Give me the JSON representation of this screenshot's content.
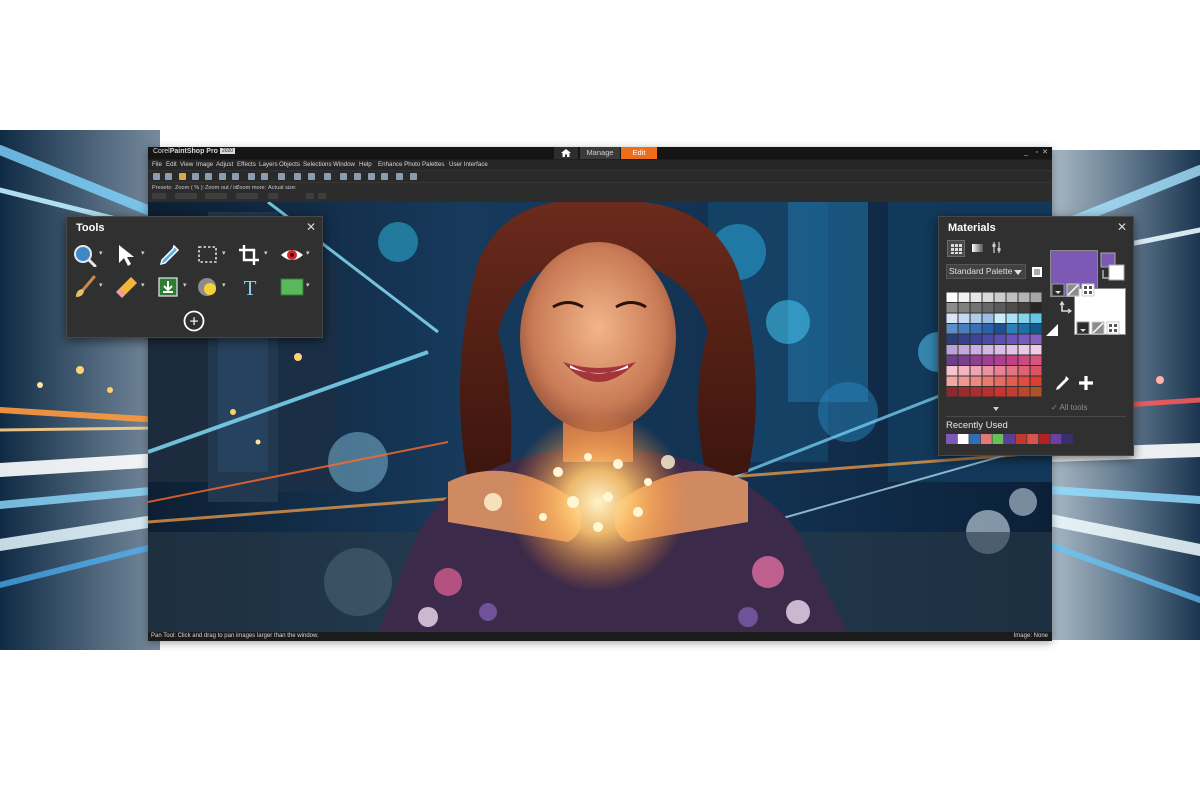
{
  "app": {
    "title_prefix": "Corel",
    "title_brand": "PaintShop Pro",
    "title_year": "2020",
    "tabs": [
      {
        "label": "Manage",
        "active": false
      },
      {
        "label": "Edit",
        "active": true
      }
    ],
    "window_controls": [
      "_",
      "▫",
      "✕"
    ]
  },
  "menu": [
    "File",
    "Edit",
    "View",
    "Image",
    "Adjust",
    "Effects",
    "Layers",
    "Objects",
    "Selections",
    "Window",
    "Help",
    "Enhance Photo",
    "Palettes",
    "User Interface"
  ],
  "options_bar": {
    "labels": [
      "Presets:",
      "Zoom ( % ):",
      "Zoom out / in:",
      "Zoom more:",
      "Actual size:"
    ]
  },
  "status": {
    "hint": "Pan Tool: Click and drag to pan images larger than the window.",
    "image_info": "Image: None"
  },
  "tools_panel": {
    "title": "Tools",
    "close_glyph": "✕",
    "tools": [
      {
        "name": "zoom-tool",
        "has_flyout": true
      },
      {
        "name": "pick-tool",
        "has_flyout": true
      },
      {
        "name": "dropper-tool",
        "has_flyout": false
      },
      {
        "name": "selection-tool",
        "has_flyout": true
      },
      {
        "name": "crop-tool",
        "has_flyout": true
      },
      {
        "name": "red-eye-tool",
        "has_flyout": true
      },
      {
        "name": "paint-brush-tool",
        "has_flyout": true
      },
      {
        "name": "eraser-tool",
        "has_flyout": true
      },
      {
        "name": "clone-tool",
        "has_flyout": true
      },
      {
        "name": "dodge-tool",
        "has_flyout": true
      },
      {
        "name": "text-tool",
        "has_flyout": false
      },
      {
        "name": "rectangle-tool",
        "has_flyout": true
      },
      {
        "name": "add-tool",
        "has_flyout": false
      }
    ],
    "text_tool_glyph": "T",
    "add_glyph": "+"
  },
  "materials_panel": {
    "title": "Materials",
    "close_glyph": "✕",
    "palette_name": "Standard Palette",
    "all_tools_label": "All tools",
    "recently_used_label": "Recently Used",
    "foreground_color": "#7b59b5",
    "background_color": "#ffffff",
    "recent_colors": [
      "#7b59b5",
      "#ffffff",
      "#2f6fb6",
      "#e07a7a",
      "#6bbf59",
      "#5a3f9a",
      "#c0392b",
      "#d9534f",
      "#b22222",
      "#6c3fa0",
      "#3a2f6e"
    ],
    "swatch_rows": [
      [
        "#ffffff",
        "#f2f2f2",
        "#e6e6e6",
        "#d9d9d9",
        "#cccccc",
        "#bfbfbf",
        "#b3b3b3",
        "#a6a6a6"
      ],
      [
        "#8c8c8c",
        "#808080",
        "#737373",
        "#666666",
        "#5a5a5a",
        "#4d4d4d",
        "#404040",
        "#262626"
      ],
      [
        "#d9e7f5",
        "#c5d9ef",
        "#b0cbe8",
        "#9bbde1",
        "#c8eef7",
        "#a9e2f2",
        "#85d4ec",
        "#63c6e6"
      ],
      [
        "#5a8fc8",
        "#4a7fbe",
        "#3a6fb4",
        "#2a5faa",
        "#1f4e91",
        "#2c7fb8",
        "#1d6fa8",
        "#125a8e"
      ],
      [
        "#2a3f7a",
        "#34408a",
        "#3e4599",
        "#4a4aa6",
        "#5a4fb0",
        "#6a54b8",
        "#7a59bf",
        "#8a5fc5"
      ],
      [
        "#b9a3d9",
        "#c2a9dc",
        "#caafdf",
        "#d4b6e2",
        "#dcbce4",
        "#e4c2e6",
        "#eac8e6",
        "#f0cde6"
      ],
      [
        "#6b3f8a",
        "#7c3f8f",
        "#8e3f92",
        "#a03f93",
        "#b23f8e",
        "#c23f86",
        "#cc4a80",
        "#d6557a"
      ],
      [
        "#f6c3cf",
        "#f3b3c0",
        "#f0a3b1",
        "#ec93a2",
        "#e88393",
        "#e47384",
        "#e06375",
        "#dc5366"
      ],
      [
        "#f2a7a0",
        "#ef9890",
        "#ec8980",
        "#e97a70",
        "#e66b60",
        "#e35c50",
        "#e04d40",
        "#dd3e30"
      ],
      [
        "#8a2a2a",
        "#9a2c2c",
        "#aa2e2e",
        "#ba3030",
        "#ca3232",
        "#c23d2f",
        "#b8482c",
        "#ae5329"
      ]
    ]
  }
}
